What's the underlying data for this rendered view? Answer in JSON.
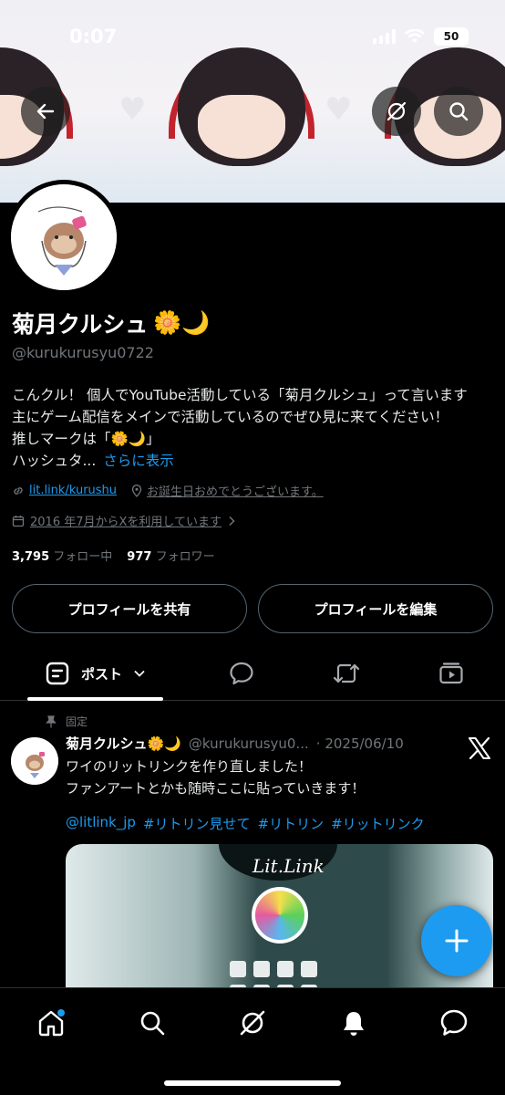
{
  "status_bar": {
    "time": "0:07",
    "battery": "50"
  },
  "profile": {
    "name": "菊月クルシュ",
    "name_emojis": "🌼🌙",
    "handle": "@kurukurusyu0722",
    "bio_lines": [
      "こんクル！ 個人でYouTube活動している「菊月クルシュ」って言います",
      "主にゲーム配信をメインで活動しているのでぜひ見に来てください！",
      "推しマークは「🌼🌙」",
      "ハッシュタ..."
    ],
    "bio_more": "さらに表示",
    "link": "lit.link/kurushu",
    "location": "お誕生日おめでとうございます。",
    "joined": "2016 年7月からXを利用しています",
    "following_count": "3,795",
    "following_label": "フォロー中",
    "followers_count": "977",
    "followers_label": "フォロワー",
    "share_button": "プロフィールを共有",
    "edit_button": "プロフィールを編集"
  },
  "tabs": {
    "posts_label": "ポスト"
  },
  "pinned_post": {
    "pinned_label": "固定",
    "author_name": "菊月クルシュ",
    "author_emojis": "🌼🌙",
    "author_handle": "@kurukurusyu0...",
    "date": "· 2025/06/10",
    "text_lines": [
      "ワイのリットリンクを作り直しました！",
      "ファンアートとかも随時ここに貼っていきます！"
    ],
    "tags": [
      "@litlink_jp",
      "#リトリン見せて",
      "#リトリン",
      "#リットリンク"
    ],
    "image_caption": "Lit.Link"
  },
  "colors": {
    "accent": "#1d9bf0",
    "background": "#000000",
    "muted": "#71767b"
  }
}
